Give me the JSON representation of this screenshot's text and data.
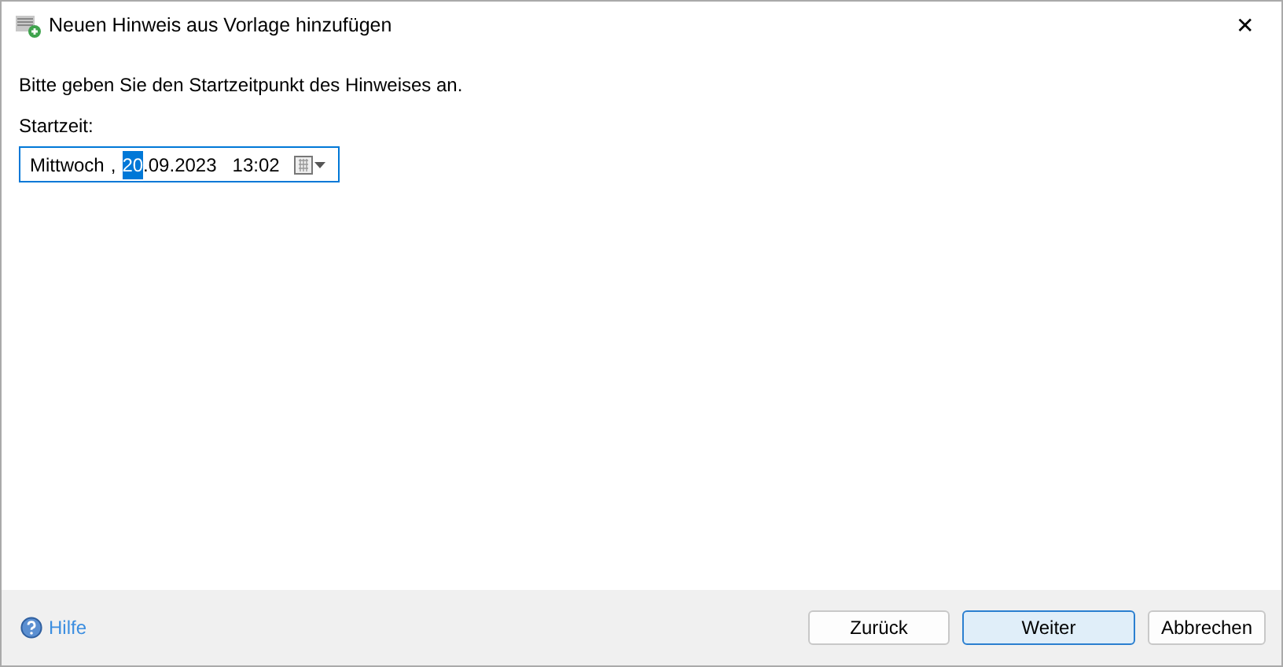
{
  "window": {
    "title": "Neuen Hinweis aus Vorlage hinzufügen",
    "close": "✕"
  },
  "instruction": "Bitte geben Sie den Startzeitpunkt des Hinweises an.",
  "start_field": {
    "label": "Startzeit:",
    "segments": [
      {
        "text": "Mittwoch",
        "selected": false
      },
      {
        "text": ",",
        "selected": false
      },
      {
        "text": "20",
        "selected": true
      },
      {
        "text": ".09.2023",
        "selected": false
      },
      {
        "text": "13:02",
        "selected": false
      }
    ]
  },
  "footer": {
    "help": "Hilfe",
    "buttons": [
      {
        "label": "Zurück",
        "default": false
      },
      {
        "label": "Weiter",
        "default": true
      },
      {
        "label": "Abbrechen",
        "default": false
      }
    ]
  }
}
